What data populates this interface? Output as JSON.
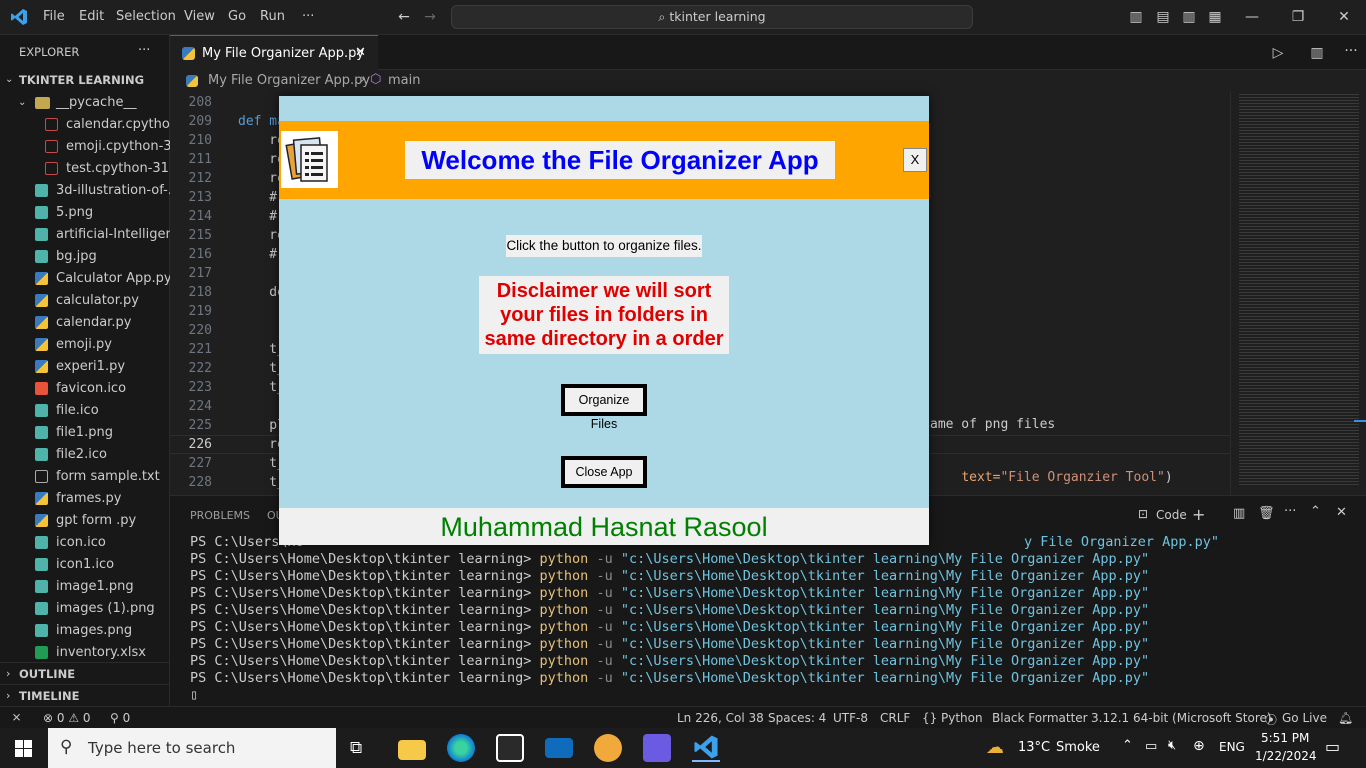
{
  "titlebar": {
    "menu": [
      "File",
      "Edit",
      "Selection",
      "View",
      "Go",
      "Run",
      "···"
    ],
    "search": "tkinter learning"
  },
  "sidebar": {
    "header": "EXPLORER",
    "more": "···",
    "section": "TKINTER LEARNING",
    "folder": "__pycache__",
    "items": [
      {
        "label": "calendar.cpytho...",
        "icon": "binary-file-icon",
        "indent": 2
      },
      {
        "label": "emoji.cpython-3...",
        "icon": "binary-file-icon",
        "indent": 2
      },
      {
        "label": "test.cpython-31...",
        "icon": "binary-file-icon",
        "indent": 2
      },
      {
        "label": "3d-illustration-of-...",
        "icon": "image-file-icon",
        "indent": 1
      },
      {
        "label": "5.png",
        "icon": "image-file-icon",
        "indent": 1
      },
      {
        "label": "artificial-Intelligen...",
        "icon": "image-file-icon",
        "indent": 1
      },
      {
        "label": "bg.jpg",
        "icon": "image-file-icon",
        "indent": 1
      },
      {
        "label": "Calculator App.py",
        "icon": "python-file-icon",
        "indent": 1
      },
      {
        "label": "calculator.py",
        "icon": "python-file-icon",
        "indent": 1
      },
      {
        "label": "calendar.py",
        "icon": "python-file-icon",
        "indent": 1
      },
      {
        "label": "emoji.py",
        "icon": "python-file-icon",
        "indent": 1
      },
      {
        "label": "experi1.py",
        "icon": "python-file-icon",
        "indent": 1
      },
      {
        "label": "favicon.ico",
        "icon": "favicon-file-icon",
        "indent": 1
      },
      {
        "label": "file.ico",
        "icon": "image-file-icon",
        "indent": 1
      },
      {
        "label": "file1.png",
        "icon": "image-file-icon",
        "indent": 1
      },
      {
        "label": "file2.ico",
        "icon": "image-file-icon",
        "indent": 1
      },
      {
        "label": "form sample.txt",
        "icon": "text-file-icon",
        "indent": 1
      },
      {
        "label": "frames.py",
        "icon": "python-file-icon",
        "indent": 1
      },
      {
        "label": "gpt form .py",
        "icon": "python-file-icon",
        "indent": 1
      },
      {
        "label": "icon.ico",
        "icon": "image-file-icon",
        "indent": 1
      },
      {
        "label": "icon1.ico",
        "icon": "image-file-icon",
        "indent": 1
      },
      {
        "label": "image1.png",
        "icon": "image-file-icon",
        "indent": 1
      },
      {
        "label": "images (1).png",
        "icon": "image-file-icon",
        "indent": 1
      },
      {
        "label": "images.png",
        "icon": "image-file-icon",
        "indent": 1
      },
      {
        "label": "inventory.xlsx",
        "icon": "excel-file-icon",
        "indent": 1
      }
    ],
    "outline": "OUTLINE",
    "timeline": "TIMELINE"
  },
  "tab": {
    "label": "My File Organizer App.py",
    "close": "✕"
  },
  "breadcrumb": {
    "file": "My File Organizer App.py",
    "symbol": "main"
  },
  "editor": {
    "lines": [
      {
        "n": "208",
        "code": ""
      },
      {
        "n": "209",
        "code": "def ma"
      },
      {
        "n": "210",
        "code": "    re"
      },
      {
        "n": "211",
        "code": "    re"
      },
      {
        "n": "212",
        "code": "    re"
      },
      {
        "n": "213",
        "code": "    #"
      },
      {
        "n": "214",
        "code": "    #"
      },
      {
        "n": "215",
        "code": "    re"
      },
      {
        "n": "216",
        "code": "    #"
      },
      {
        "n": "217",
        "code": ""
      },
      {
        "n": "218",
        "code": "    de"
      },
      {
        "n": "219",
        "code": ""
      },
      {
        "n": "220",
        "code": ""
      },
      {
        "n": "221",
        "code": "    t_"
      },
      {
        "n": "222",
        "code": "    t_"
      },
      {
        "n": "223",
        "code": "    t_"
      },
      {
        "n": "224",
        "code": ""
      },
      {
        "n": "225",
        "code": "    pl"
      },
      {
        "n": "226",
        "code": "    re"
      },
      {
        "n": "227",
        "code": "    t_"
      },
      {
        "n": "228",
        "code": "    t_"
      }
    ],
    "right_fragment_1": "ame of png files",
    "right_fragment_2_a": "text=",
    "right_fragment_2_b": "\"File Organzier Tool\"",
    "right_fragment_2_c": ")"
  },
  "panel": {
    "tabs": [
      "PROBLEMS",
      "OU"
    ],
    "terminal_label": "Code",
    "prompt": "PS C:\\Users\\Home\\Desktop\\tkinter learning>",
    "cmd": "python",
    "flag": "-u",
    "arg": "\"c:\\Users\\Home\\Desktop\\tkinter learning\\My File Organizer App.py\"",
    "first_line_fragment": "PS C:\\Users\\Ho",
    "first_line_tail": "y File Organizer App.py\"",
    "line_count": 8,
    "cursor": "▯"
  },
  "statusbar": {
    "remote": "⨯",
    "problems": "⊗ 0 ⚠ 0",
    "ports": "⚲ 0",
    "position": "Ln 226, Col 38",
    "spaces": "Spaces: 4",
    "encoding": "UTF-8",
    "eol": "CRLF",
    "language": "Python",
    "formatter": "Black Formatter",
    "interpreter": "3.12.1 64-bit (Microsoft Store)",
    "golive": "Go Live"
  },
  "taskbar": {
    "search": "Type here to search",
    "weather_temp": "13°C",
    "weather_desc": "Smoke",
    "lang": "ENG",
    "time": "5:51 PM",
    "date": "1/22/2024"
  },
  "tkapp": {
    "title": "Welcome the File Organizer App",
    "close": "X",
    "instruction": "Click the button to organize files.",
    "disclaimer": "Disclaimer we will sort your files in folders in same directory in a order",
    "organize_button": "Organize Files",
    "close_button": "Close App",
    "footer": "Muhammad Hasnat Rasool",
    "colors": {
      "background": "#add8e6",
      "header": "#ffa500",
      "title_text": "#0000ff",
      "disclaimer_text": "#e00000",
      "footer_text": "#008000"
    }
  }
}
